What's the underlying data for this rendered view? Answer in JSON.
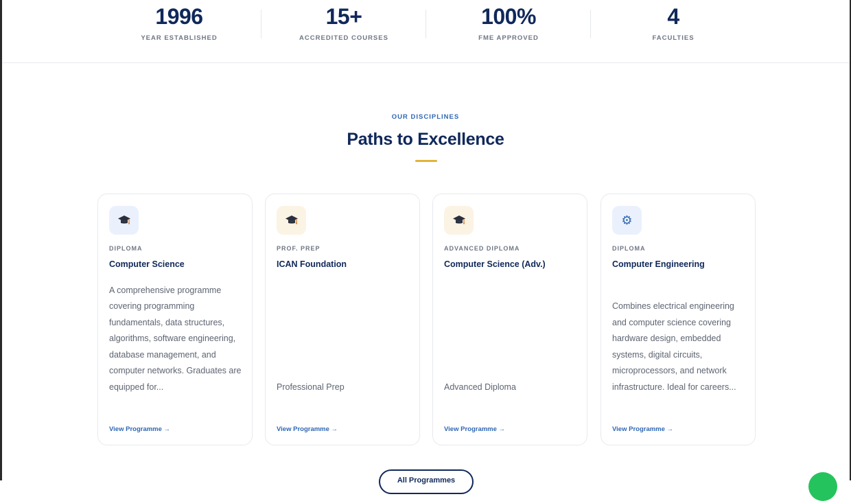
{
  "stats": [
    {
      "value": "1996",
      "label": "YEAR ESTABLISHED"
    },
    {
      "value": "15+",
      "label": "ACCREDITED COURSES"
    },
    {
      "value": "100%",
      "label": "FME APPROVED"
    },
    {
      "value": "4",
      "label": "FACULTIES"
    }
  ],
  "section": {
    "eyebrow": "OUR DISCIPLINES",
    "title": "Paths to Excellence",
    "accent_color": "#e0b43a"
  },
  "cards": [
    {
      "icon": "graduation-cap-icon",
      "tag": "DIPLOMA",
      "title": "Computer Science",
      "description": "A comprehensive programme covering programming fundamentals, data structures, algorithms, software engineering, database management, and computer networks. Graduates are equipped for...",
      "link": "View Programme →"
    },
    {
      "icon": "graduation-cap-icon",
      "tag": "PROF. PREP",
      "title": "ICAN Foundation",
      "description": "Professional Prep",
      "link": "View Programme →"
    },
    {
      "icon": "graduation-cap-icon",
      "tag": "ADVANCED DIPLOMA",
      "title": "Computer Science (Adv.)",
      "description": "Advanced Diploma",
      "link": "View Programme →"
    },
    {
      "icon": "gear-icon",
      "tag": "DIPLOMA",
      "title": "Computer Engineering",
      "description": "Combines electrical engineering and computer science covering hardware design, embedded systems, digital circuits, microprocessors, and network infrastructure. Ideal for careers...",
      "link": "View Programme →"
    }
  ],
  "all_button": {
    "label": "All Programmes"
  },
  "colors": {
    "navy": "#10285a",
    "link_blue": "#2f66b3",
    "whatsapp_green": "#25c35d"
  }
}
